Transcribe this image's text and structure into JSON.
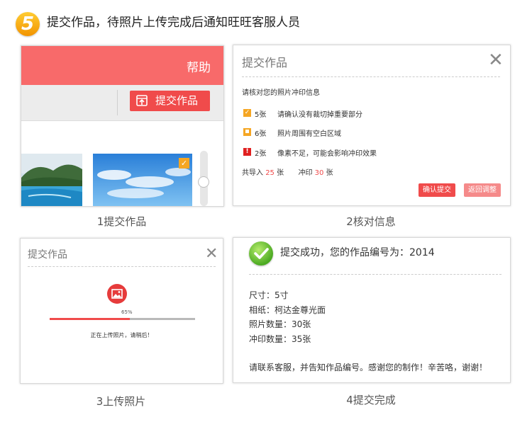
{
  "step_number": "5",
  "heading": "提交作品，待照片上传完成后通知旺旺客服人员",
  "captions": {
    "c1": "1提交作品",
    "c2": "2核对信息",
    "c3": "3上传照片",
    "c4": "4提交完成"
  },
  "panel1": {
    "help": "帮助",
    "submit_label": "提交作品"
  },
  "panel2": {
    "title": "提交作品",
    "subtitle": "请核对您的照片冲印信息",
    "rows": [
      {
        "count": "5张",
        "text": "请确认没有裁切掉重要部分",
        "color": "#f5a623"
      },
      {
        "count": "6张",
        "text": "照片周围有空白区域",
        "color": "#f5a623"
      },
      {
        "count": "2张",
        "text": "像素不足，可能会影响冲印效果",
        "color": "#e02020"
      }
    ],
    "summary": {
      "import_label": "共导入",
      "import_count": "25",
      "unit1": "张",
      "print_label": "冲印",
      "print_count": "30",
      "unit2": "张"
    },
    "confirm_label": "确认提交",
    "back_label": "返回调整"
  },
  "panel3": {
    "title": "提交作品",
    "progress_text": "65%",
    "progress": 0.55,
    "status": "正在上传照片，请稍后！"
  },
  "panel4": {
    "success": "提交成功，您的作品编号为：2014",
    "details": [
      "尺寸：5寸",
      "相纸：柯达金尊光面",
      "照片数量：30张",
      "冲印数量：35张"
    ],
    "note": "请联系客服，并告知作品编号。感谢您的制作！辛苦咯，谢谢！"
  },
  "colors": {
    "accent": "#f04b4b",
    "header": "#f86a6a",
    "warning": "#f5a623",
    "success": "#4caa22"
  }
}
